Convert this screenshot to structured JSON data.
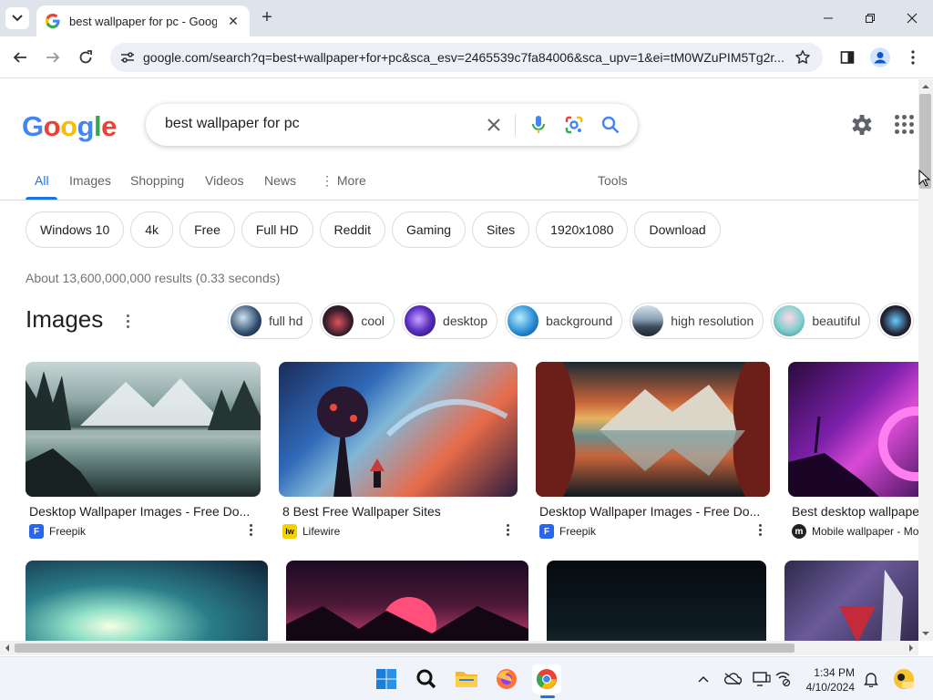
{
  "browser": {
    "tab_title": "best wallpaper for pc - Google",
    "url": "google.com/search?q=best+wallpaper+for+pc&sca_esv=2465539c7fa84006&sca_upv=1&ei=tM0WZuPIM5Tg2r..."
  },
  "search": {
    "logo": [
      "G",
      "o",
      "o",
      "g",
      "l",
      "e"
    ],
    "query": "best wallpaper for pc"
  },
  "nav_tabs": [
    "All",
    "Images",
    "Shopping",
    "Videos",
    "News",
    "More",
    "Tools"
  ],
  "refine_chips": [
    "Windows 10",
    "4k",
    "Free",
    "Full HD",
    "Reddit",
    "Gaming",
    "Sites",
    "1920x1080",
    "Download"
  ],
  "results_stats": "About 13,600,000,000 results (0.33 seconds)",
  "images_section": {
    "heading": "Images",
    "chips": [
      "full hd",
      "cool",
      "desktop",
      "background",
      "high resolution",
      "beautiful"
    ],
    "row1": [
      {
        "title": "Desktop Wallpaper Images - Free Do...",
        "source": "Freepik",
        "favicon": "F"
      },
      {
        "title": "8 Best Free Wallpaper Sites",
        "source": "Lifewire",
        "favicon": "lw"
      },
      {
        "title": "Desktop Wallpaper Images - Free Do...",
        "source": "Freepik",
        "favicon": "F"
      },
      {
        "title": "Best desktop wallpape",
        "source": "Mobile wallpaper - Mo",
        "favicon": "m"
      }
    ]
  },
  "taskbar": {
    "time": "1:34 PM",
    "date": "4/10/2024"
  },
  "colors": {
    "google_blue": "#4285f4",
    "google_red": "#ea4335",
    "google_yellow": "#fbbc05",
    "google_green": "#34a853",
    "link_blue": "#1a73e8"
  }
}
